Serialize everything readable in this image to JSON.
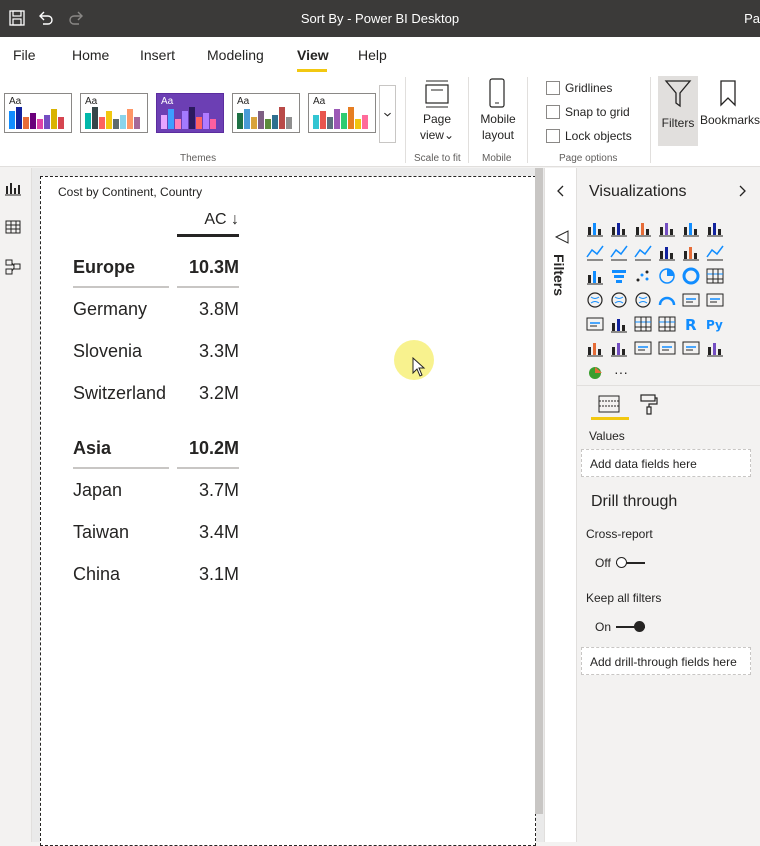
{
  "window": {
    "title": "Sort By - Power BI Desktop",
    "title_right": "Pa"
  },
  "menu": {
    "items": [
      "File",
      "Home",
      "Insert",
      "Modeling",
      "View",
      "Help"
    ],
    "active": "View"
  },
  "ribbon": {
    "theme_aa": "Aa",
    "themes_label": "Themes",
    "page_view_label": "Page",
    "page_view_label2": "view",
    "scale_to_fit_label": "Scale to fit",
    "mobile_layout_label": "Mobile",
    "mobile_layout_label2": "layout",
    "mobile_group_label": "Mobile",
    "gridlines_label": "Gridlines",
    "snap_label": "Snap to grid",
    "lock_label": "Lock objects",
    "page_options_label": "Page options",
    "filters_label": "Filters",
    "bookmarks_label": "Bookmarks"
  },
  "visual": {
    "title": "Cost by Continent, Country",
    "column_header": "AC ↓",
    "groups": [
      {
        "label": "Europe",
        "value": "10.3M",
        "rows": [
          {
            "label": "Germany",
            "value": "3.8M"
          },
          {
            "label": "Slovenia",
            "value": "3.3M"
          },
          {
            "label": "Switzerland",
            "value": "3.2M"
          }
        ]
      },
      {
        "label": "Asia",
        "value": "10.2M",
        "rows": [
          {
            "label": "Japan",
            "value": "3.7M"
          },
          {
            "label": "Taiwan",
            "value": "3.4M"
          },
          {
            "label": "China",
            "value": "3.1M"
          }
        ]
      }
    ]
  },
  "filters_pane": {
    "label": "Filters"
  },
  "viz_pane": {
    "title": "Visualizations",
    "more": "···",
    "values_label": "Values",
    "values_well": "Add data fields here",
    "drill_title": "Drill through",
    "cross_report_label": "Cross-report",
    "cross_report_state": "Off",
    "keep_filters_label": "Keep all filters",
    "keep_filters_state": "On",
    "drill_well": "Add drill-through fields here"
  },
  "colors": {
    "accent": "#f2c811",
    "titlebar": "#3b3a39",
    "theme_selected": "#6c3fb4"
  }
}
